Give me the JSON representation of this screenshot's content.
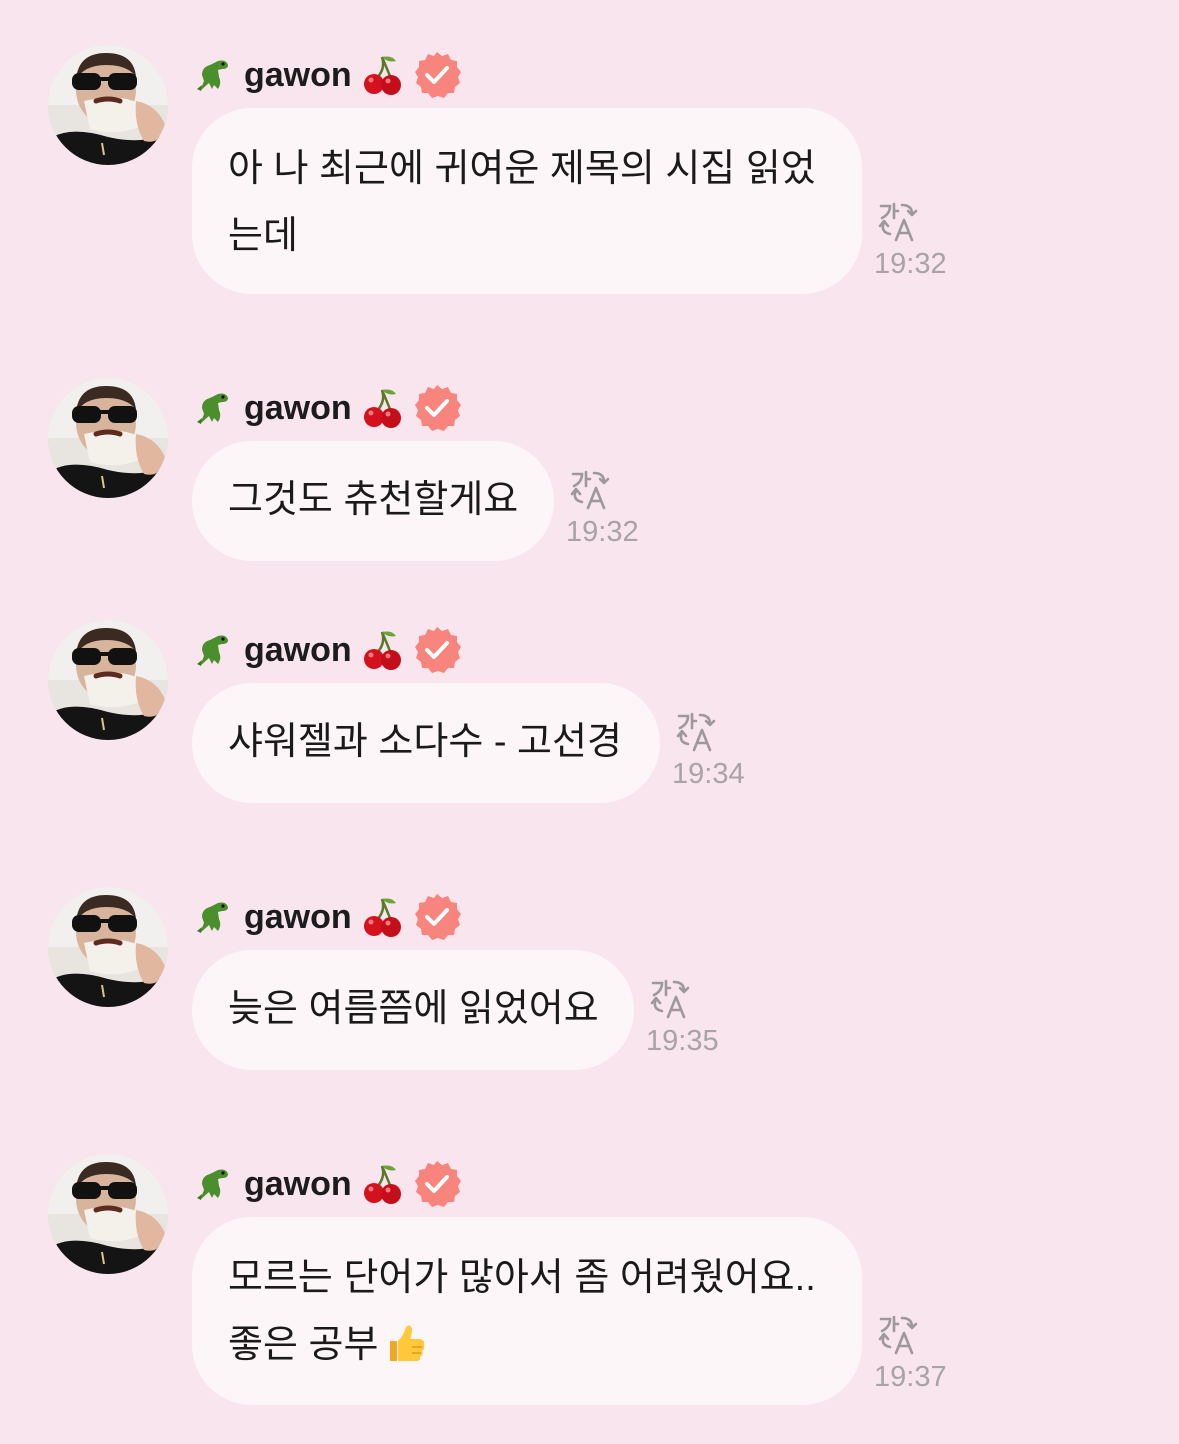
{
  "messages": [
    {
      "username": "gawon",
      "lines": [
        "아 나 최근에 귀여운 제목의 시집 읽었",
        "는데"
      ],
      "time": "19:32"
    },
    {
      "username": "gawon",
      "lines": [
        "그것도 츄천할게요"
      ],
      "time": "19:32"
    },
    {
      "username": "gawon",
      "lines": [
        "샤워젤과 소다수 - 고선경"
      ],
      "time": "19:34"
    },
    {
      "username": "gawon",
      "lines": [
        "늦은 여름쯤에 읽었어요"
      ],
      "time": "19:35"
    },
    {
      "username": "gawon",
      "lines": [
        "모르는 단어가 많아서 좀 어려웠어요..",
        "좋은 공부"
      ],
      "time": "19:37",
      "trailing_emoji": "thumbs-up"
    }
  ],
  "icons": {
    "prefix_emoji": "t-rex-icon",
    "suffix_emoji": "cherry-icon",
    "badge": "verified-badge-icon",
    "translate": "translate-icon"
  },
  "colors": {
    "background": "#f9e5ee",
    "bubble": "#fdf6f9",
    "badge": "#f7857d",
    "time": "#a8a3a6"
  }
}
